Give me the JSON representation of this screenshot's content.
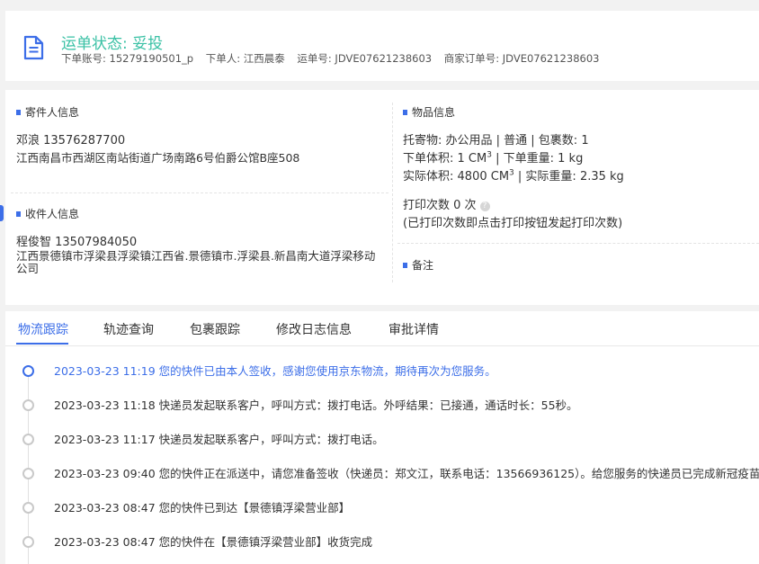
{
  "header": {
    "status": "运单状态: 妥投",
    "account": "下单账号: 15279190501_p",
    "orderer": "下单人: 江西晨泰",
    "waybill": "运单号: JDVE07621238603",
    "merchant_order": "商家订单号: JDVE07621238603"
  },
  "sender": {
    "title": "寄件人信息",
    "name_phone": "邓浪   13576287700",
    "address": "江西南昌市西湖区南站街道广场南路6号伯爵公馆B座508"
  },
  "receiver": {
    "title": "收件人信息",
    "name_phone": "程俊智   13507984050",
    "address": "江西景德镇市浮梁县浮梁镇江西省.景德镇市.浮梁县.新昌南大道浮梁移动公司"
  },
  "goods": {
    "title": "物品信息",
    "line1": "托寄物:  办公用品 | 普通  |  包裹数:  1",
    "vol_label": "下单体积:",
    "vol_value": "1 CM",
    "vol_sup": "3",
    "weight": "|  下单重量:  1 kg",
    "actual_vol_label": "实际体积:",
    "actual_vol_value": "4800 CM",
    "actual_vol_sup": "3",
    "actual_weight": "|  实际重量:  2.35 kg",
    "print_count": "打印次数   0 次",
    "help_glyph": "?",
    "print_note": "(已打印次数即点击打印按钮发起打印次数)"
  },
  "remarks": {
    "title": "备注"
  },
  "tabs": [
    "物流跟踪",
    "轨迹查询",
    "包裹跟踪",
    "修改日志信息",
    "审批详情"
  ],
  "timeline": [
    "2023-03-23 11:19 您的快件已由本人签收，感谢您使用京东物流，期待再次为您服务。",
    "2023-03-23 11:18 快递员发起联系客户，呼叫方式：拨打电话。外呼结果：已接通，通话时长：55秒。",
    "2023-03-23 11:17 快递员发起联系客户，呼叫方式：拨打电话。",
    "2023-03-23 09:40 您的快件正在派送中，请您准备签收（快递员：郑文江，联系电话：13566936125）。给您服务的快递员已完成新冠疫苗接种，请放心签收。",
    "2023-03-23 08:47 您的快件已到达【景德镇浮梁营业部】",
    "2023-03-23 08:47 您的快件在【景德镇浮梁营业部】收货完成"
  ],
  "colors": {
    "accent": "#3c6ee8",
    "status": "#3ac1a5"
  }
}
